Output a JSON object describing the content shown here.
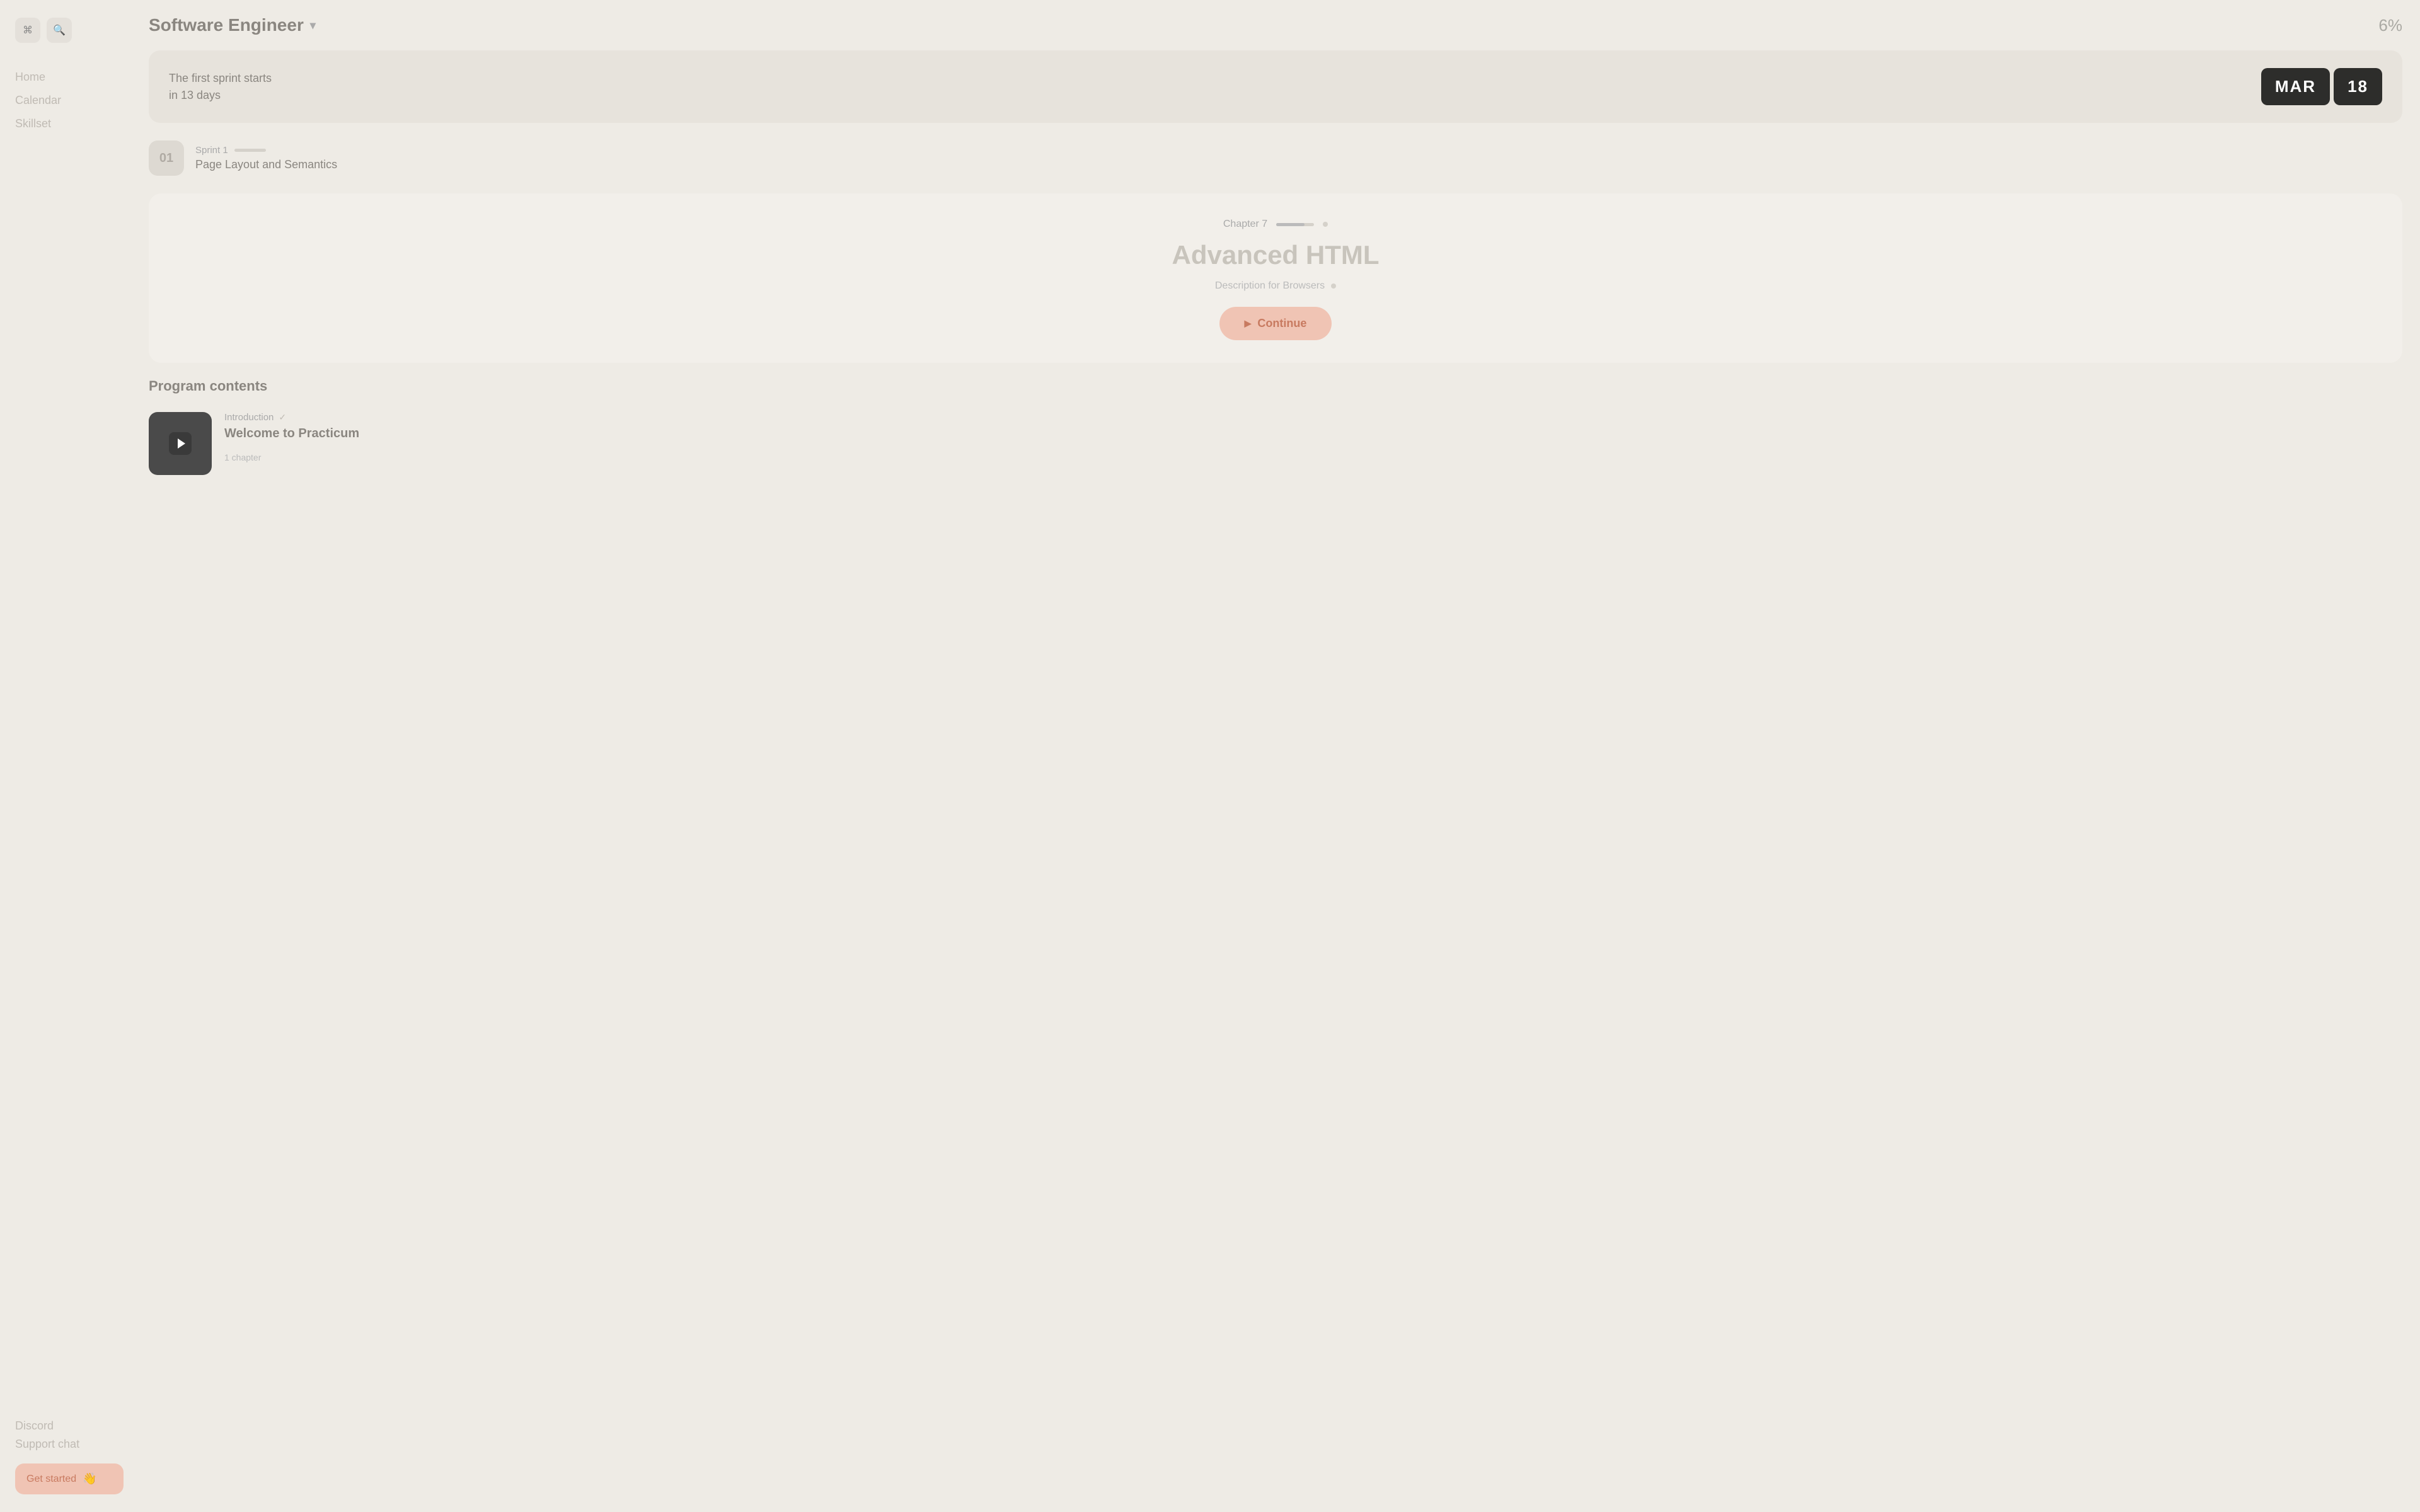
{
  "sidebar": {
    "icon_menu": "☰",
    "icon_search": "⌕",
    "nav": [
      {
        "label": "Home",
        "active": false
      },
      {
        "label": "Calendar",
        "active": false
      },
      {
        "label": "Skillset",
        "active": false
      }
    ],
    "bottom_nav": [
      {
        "label": "Discord"
      },
      {
        "label": "Support chat"
      }
    ],
    "get_started_label": "Get started",
    "wave_icon": "👋"
  },
  "header": {
    "course_title": "Software Engineer",
    "progress": "6%"
  },
  "sprint_banner": {
    "text_line1": "The first sprint starts",
    "text_line2": "in 13 days",
    "month_badge": "MAR",
    "day_badge": "18"
  },
  "sprint": {
    "number": "01",
    "label": "Sprint 1",
    "title": "Page Layout and Semantics"
  },
  "chapter": {
    "label": "Chapter 7",
    "title": "Advanced HTML",
    "subtitle": "Description for Browsers",
    "continue_label": "Continue"
  },
  "program_contents": {
    "section_title": "Program contents",
    "items": [
      {
        "intro_label": "Introduction",
        "check": "✓",
        "name": "Welcome to Practicum",
        "chapters": "1 chapter"
      }
    ]
  }
}
